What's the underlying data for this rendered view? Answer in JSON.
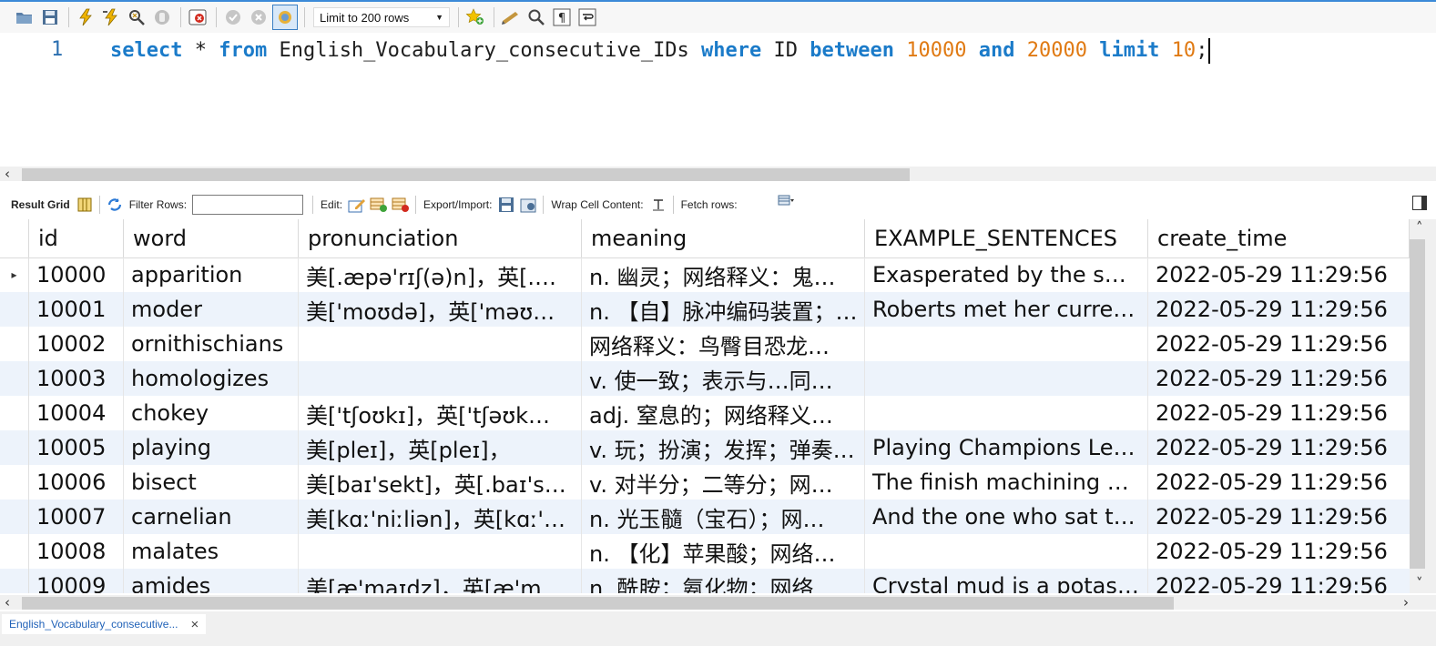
{
  "toolbar": {
    "limit_select": "Limit to 200 rows"
  },
  "editor": {
    "line_number": "1",
    "tokens": {
      "select": "select",
      "star": " * ",
      "from": "from",
      "table": " English_Vocabulary_consecutive_IDs ",
      "where": "where",
      "id": " ID ",
      "between": "between",
      "low": "10000",
      "and": "and",
      "high": "20000",
      "limit": "limit",
      "limit_val": "10",
      "semicolon": ";"
    }
  },
  "result_toolbar": {
    "result_grid": "Result Grid",
    "filter_rows": "Filter Rows:",
    "filter_value": "",
    "edit": "Edit:",
    "export_import": "Export/Import:",
    "wrap_cell": "Wrap Cell Content:",
    "fetch_rows": "Fetch rows:"
  },
  "grid": {
    "columns": [
      "id",
      "word",
      "pronunciation",
      "meaning",
      "EXAMPLE_SENTENCES",
      "create_time"
    ],
    "rows": [
      {
        "id": "10000",
        "word": "apparition",
        "pron": "美[.æpə'rɪʃ(ə)n]，英[.…",
        "mean": "n. 幽灵；网络释义：鬼…",
        "ex": "Exasperated by the s…",
        "time": "2022-05-29 11:29:56"
      },
      {
        "id": "10001",
        "word": "moder",
        "pron": "美['moʊdə]，英['məʊ…",
        "mean": "n. 【自】脉冲编码装置；…",
        "ex": "Roberts met her curre…",
        "time": "2022-05-29 11:29:56"
      },
      {
        "id": "10002",
        "word": "ornithischians",
        "pron": "",
        "mean": "网络释义：鸟臀目恐龙…",
        "ex": "",
        "time": "2022-05-29 11:29:56"
      },
      {
        "id": "10003",
        "word": "homologizes",
        "pron": "",
        "mean": "v. 使一致；表示与…同…",
        "ex": "",
        "time": "2022-05-29 11:29:56"
      },
      {
        "id": "10004",
        "word": "chokey",
        "pron": "美['tʃoʊkɪ]，英['tʃəʊk…",
        "mean": "adj. 窒息的；网络释义…",
        "ex": "",
        "time": "2022-05-29 11:29:56"
      },
      {
        "id": "10005",
        "word": "playing",
        "pron": "美[pleɪ]，英[pleɪ]，",
        "mean": "v. 玩；扮演；发挥；弹奏…",
        "ex": "Playing Champions Le…",
        "time": "2022-05-29 11:29:56"
      },
      {
        "id": "10006",
        "word": "bisect",
        "pron": "美[baɪ'sekt]，英[.baɪ's…",
        "mean": "v. 对半分；二等分；网…",
        "ex": "The finish machining …",
        "time": "2022-05-29 11:29:56"
      },
      {
        "id": "10007",
        "word": "carnelian",
        "pron": "美[kɑː'niːliən]，英[kɑː'…",
        "mean": "n. 光玉髓（宝石）；网…",
        "ex": "And the one who sat t…",
        "time": "2022-05-29 11:29:56"
      },
      {
        "id": "10008",
        "word": "malates",
        "pron": "",
        "mean": "n. 【化】苹果酸；网络…",
        "ex": "",
        "time": "2022-05-29 11:29:56"
      },
      {
        "id": "10009",
        "word": "amides",
        "pron": "美[æ'maɪdz]，英[æ'm…",
        "mean": "n. 酰胺；氨化物；网络…",
        "ex": "Crystal mud is a potas…",
        "time": "2022-05-29 11:29:56"
      }
    ]
  },
  "bottom_tab": {
    "label": "English_Vocabulary_consecutive...",
    "close": "×"
  },
  "icons": [
    "folder-open-icon",
    "save-icon",
    "execute-icon",
    "execute-selection-icon",
    "explain-icon",
    "stop-icon",
    "toggle-error-icon",
    "commit-icon",
    "rollback-icon",
    "autocommit-icon",
    "favorites-icon",
    "beautify-icon",
    "find-icon",
    "invisible-chars-icon",
    "wrap-icon"
  ]
}
